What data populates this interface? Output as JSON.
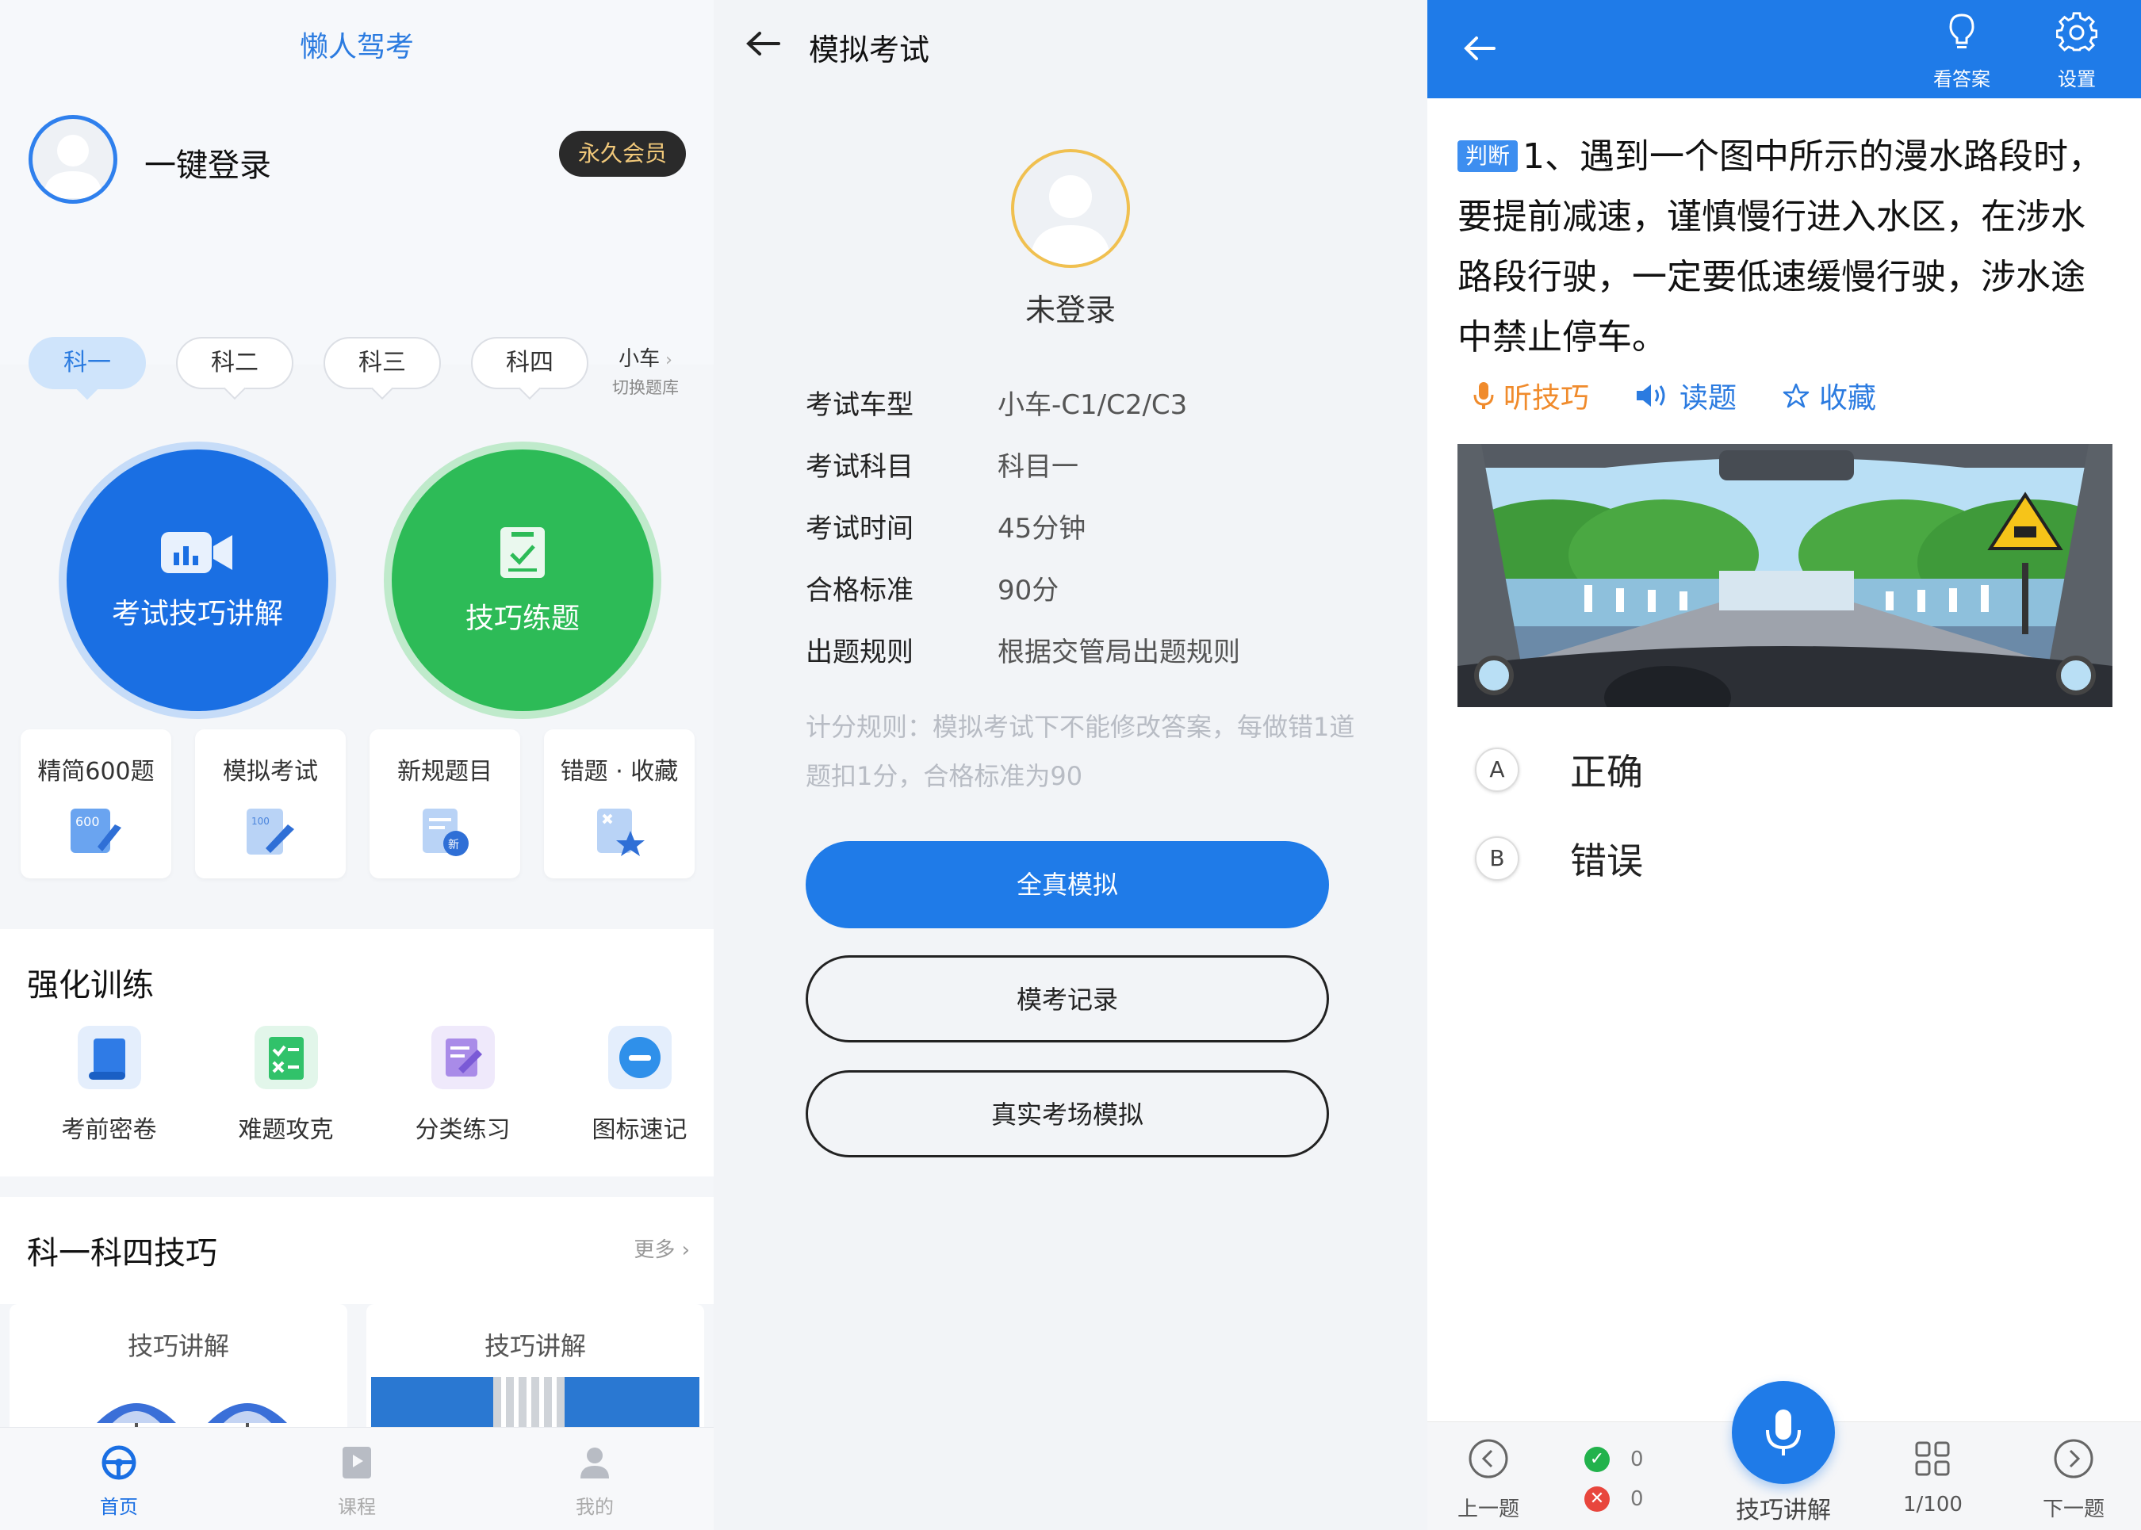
{
  "panel1": {
    "app_title": "懒人驾考",
    "login_text": "一键登录",
    "vip_badge": "永久会员",
    "subject_tabs": [
      "科一",
      "科二",
      "科三",
      "科四"
    ],
    "active_tab": "科一",
    "switch_bank": {
      "car": "小车",
      "label": "切换题库"
    },
    "big_buttons": {
      "left": "考试技巧讲解",
      "right": "技巧练题"
    },
    "features": [
      {
        "label": "精简600题",
        "icon": "600-rocket-icon"
      },
      {
        "label": "模拟考试",
        "icon": "exam-paper-pen-icon"
      },
      {
        "label": "新规题目",
        "icon": "new-doc-icon"
      },
      {
        "label": "错题 · 收藏",
        "icon": "wrong-star-icon"
      }
    ],
    "intensive": {
      "title": "强化训练",
      "items": [
        {
          "label": "考前密卷",
          "icon": "scroll-icon"
        },
        {
          "label": "难题攻克",
          "icon": "checklist-icon"
        },
        {
          "label": "分类练习",
          "icon": "edit-note-icon"
        },
        {
          "label": "图标速记",
          "icon": "sign-icon"
        }
      ]
    },
    "tips": {
      "title": "科一科四技巧",
      "more": "更多",
      "cards": [
        "技巧讲解",
        "技巧讲解"
      ]
    },
    "tabbar": [
      {
        "label": "首页",
        "icon": "steering-wheel-icon",
        "active": true
      },
      {
        "label": "课程",
        "icon": "course-play-icon",
        "active": false
      },
      {
        "label": "我的",
        "icon": "person-icon",
        "active": false
      }
    ]
  },
  "panel2": {
    "title": "模拟考试",
    "status": "未登录",
    "info": [
      {
        "key": "考试车型",
        "value": "小车-C1/C2/C3"
      },
      {
        "key": "考试科目",
        "value": "科目一"
      },
      {
        "key": "考试时间",
        "value": "45分钟"
      },
      {
        "key": "合格标准",
        "value": "90分"
      },
      {
        "key": "出题规则",
        "value": "根据交管局出题规则"
      }
    ],
    "rule_note": "计分规则：模拟考试下不能修改答案，每做错1道题扣1分，合格标准为90",
    "buttons": [
      "全真模拟",
      "模考记录",
      "真实考场模拟"
    ]
  },
  "panel3": {
    "header_buttons": [
      {
        "label": "看答案",
        "icon": "lightbulb-icon"
      },
      {
        "label": "设置",
        "icon": "gear-icon"
      }
    ],
    "question": {
      "tag": "判断",
      "text": "1、遇到一个图中所示的漫水路段时，要提前减速，谨慎慢行进入水区，在涉水路段行驶，一定要低速缓慢行驶，涉水途中禁止停车。"
    },
    "actions": [
      {
        "label": "听技巧",
        "icon": "microphone-icon"
      },
      {
        "label": "读题",
        "icon": "speaker-icon"
      },
      {
        "label": "收藏",
        "icon": "star-outline-icon"
      }
    ],
    "options": [
      {
        "letter": "A",
        "text": "正确"
      },
      {
        "letter": "B",
        "text": "错误"
      }
    ],
    "footer": {
      "prev": "上一题",
      "correct_count": "0",
      "wrong_count": "0",
      "center": "技巧讲解",
      "progress": "1/100",
      "next": "下一题"
    },
    "colors": {
      "header": "#1f7be8",
      "correct": "#22b24c",
      "wrong": "#e8463d",
      "orange": "#f08b2c"
    }
  }
}
